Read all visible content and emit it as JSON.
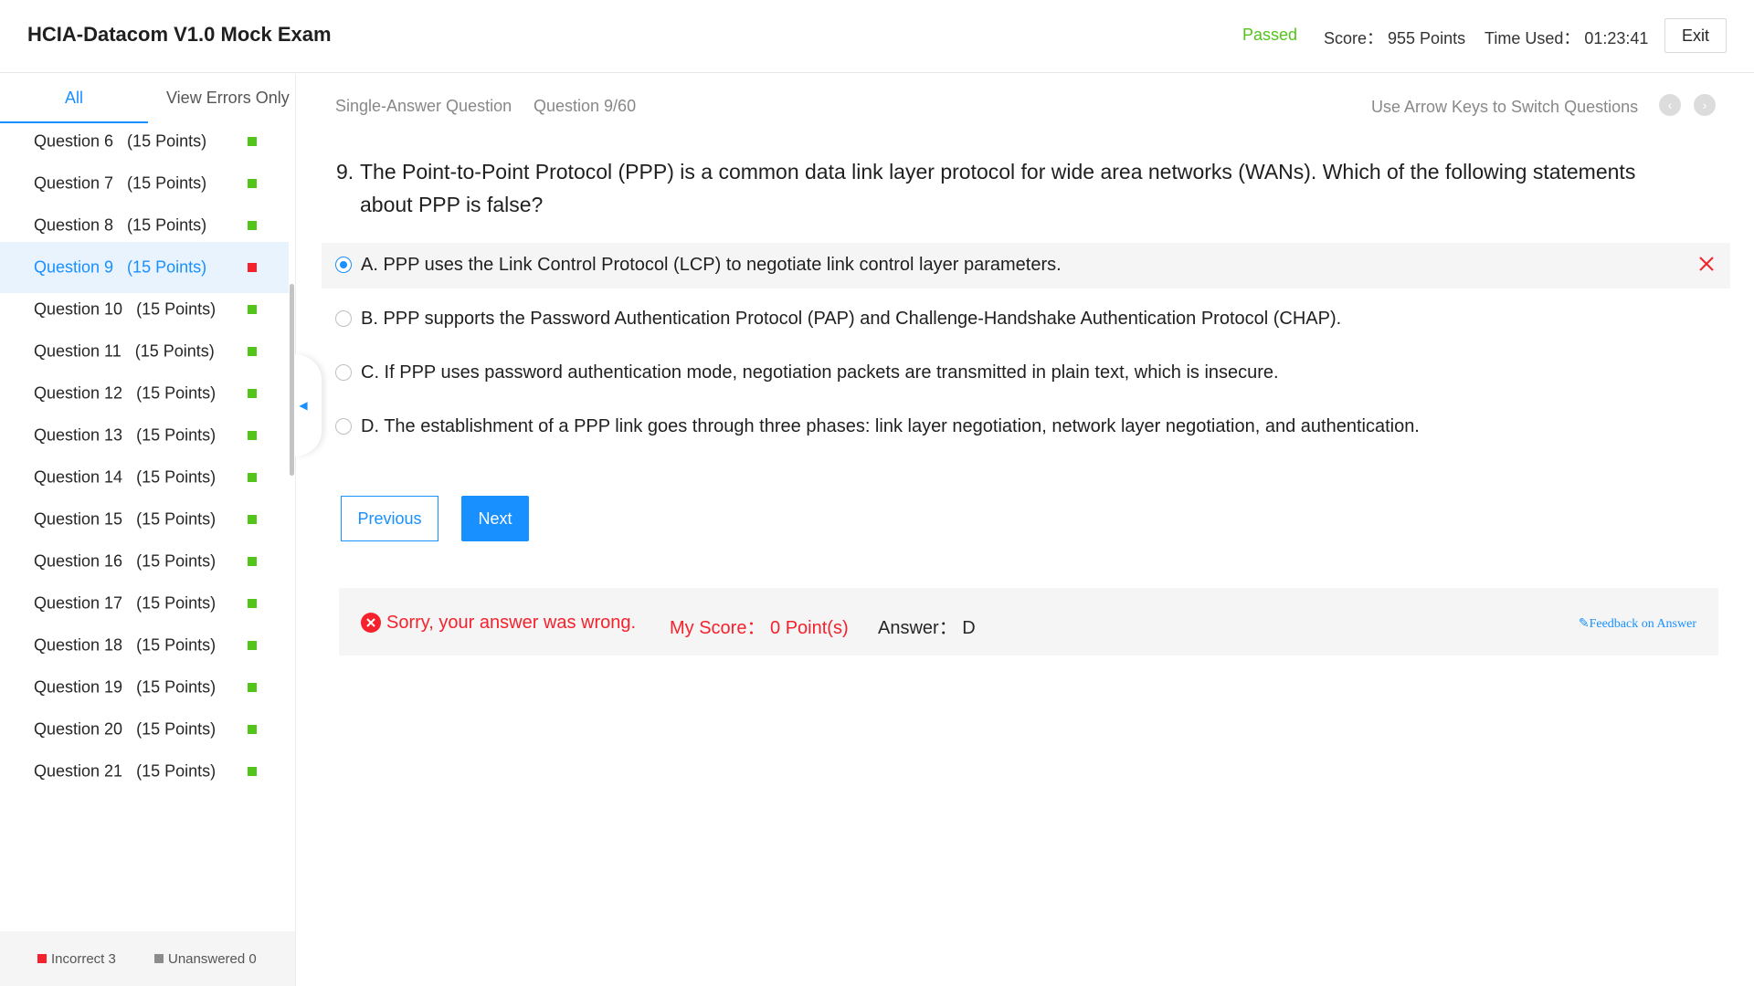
{
  "header": {
    "title": "HCIA-Datacom V1.0 Mock Exam",
    "status": "Passed",
    "score": "Score： 955 Points",
    "time_used": "Time Used： 01:23:41",
    "exit_label": "Exit"
  },
  "sidebar": {
    "tab_all": "All",
    "tab_errors": "View Errors Only",
    "questions": [
      {
        "label": "Question 6   (15 Points)",
        "status": "correct"
      },
      {
        "label": "Question 7   (15 Points)",
        "status": "correct"
      },
      {
        "label": "Question 8   (15 Points)",
        "status": "correct"
      },
      {
        "label": "Question 9   (15 Points)",
        "status": "incorrect"
      },
      {
        "label": "Question 10   (15 Points)",
        "status": "correct"
      },
      {
        "label": "Question 11   (15 Points)",
        "status": "correct"
      },
      {
        "label": "Question 12   (15 Points)",
        "status": "correct"
      },
      {
        "label": "Question 13   (15 Points)",
        "status": "correct"
      },
      {
        "label": "Question 14   (15 Points)",
        "status": "correct"
      },
      {
        "label": "Question 15   (15 Points)",
        "status": "correct"
      },
      {
        "label": "Question 16   (15 Points)",
        "status": "correct"
      },
      {
        "label": "Question 17   (15 Points)",
        "status": "correct"
      },
      {
        "label": "Question 18   (15 Points)",
        "status": "correct"
      },
      {
        "label": "Question 19   (15 Points)",
        "status": "correct"
      },
      {
        "label": "Question 20   (15 Points)",
        "status": "correct"
      },
      {
        "label": "Question 21   (15 Points)",
        "status": "correct"
      }
    ],
    "legend_incorrect": "Incorrect 3",
    "legend_unanswered": "Unanswered 0"
  },
  "colors": {
    "accent": "#1890ff",
    "correct": "#52c41a",
    "incorrect": "#f5222d",
    "unanswered": "#8c8c8c"
  },
  "question": {
    "type": "Single-Answer Question",
    "progress": "Question 9/60",
    "nav_hint": "Use Arrow Keys to Switch Questions",
    "number": "9.",
    "text": "The Point-to-Point Protocol (PPP) is a common data link layer protocol for wide area networks (WANs). Which of the following statements about PPP is false?",
    "options": [
      {
        "text": "A. PPP uses the Link Control Protocol (LCP) to negotiate link control layer parameters.",
        "selected": true,
        "wrong": true
      },
      {
        "text": "B. PPP supports the Password Authentication Protocol (PAP) and Challenge-Handshake Authentication Protocol (CHAP).",
        "selected": false,
        "wrong": false
      },
      {
        "text": "C. If PPP uses password authentication mode, negotiation packets are transmitted in plain text, which is insecure.",
        "selected": false,
        "wrong": false
      },
      {
        "text": "D. The establishment of a PPP link goes through three phases: link layer negotiation, network layer negotiation, and authentication.",
        "selected": false,
        "wrong": false
      }
    ]
  },
  "buttons": {
    "previous": "Previous",
    "next": "Next"
  },
  "result": {
    "message": "Sorry, your answer was wrong.",
    "my_score": "My Score： 0 Point(s)",
    "answer": "Answer： D",
    "feedback": "Feedback on Answer"
  }
}
